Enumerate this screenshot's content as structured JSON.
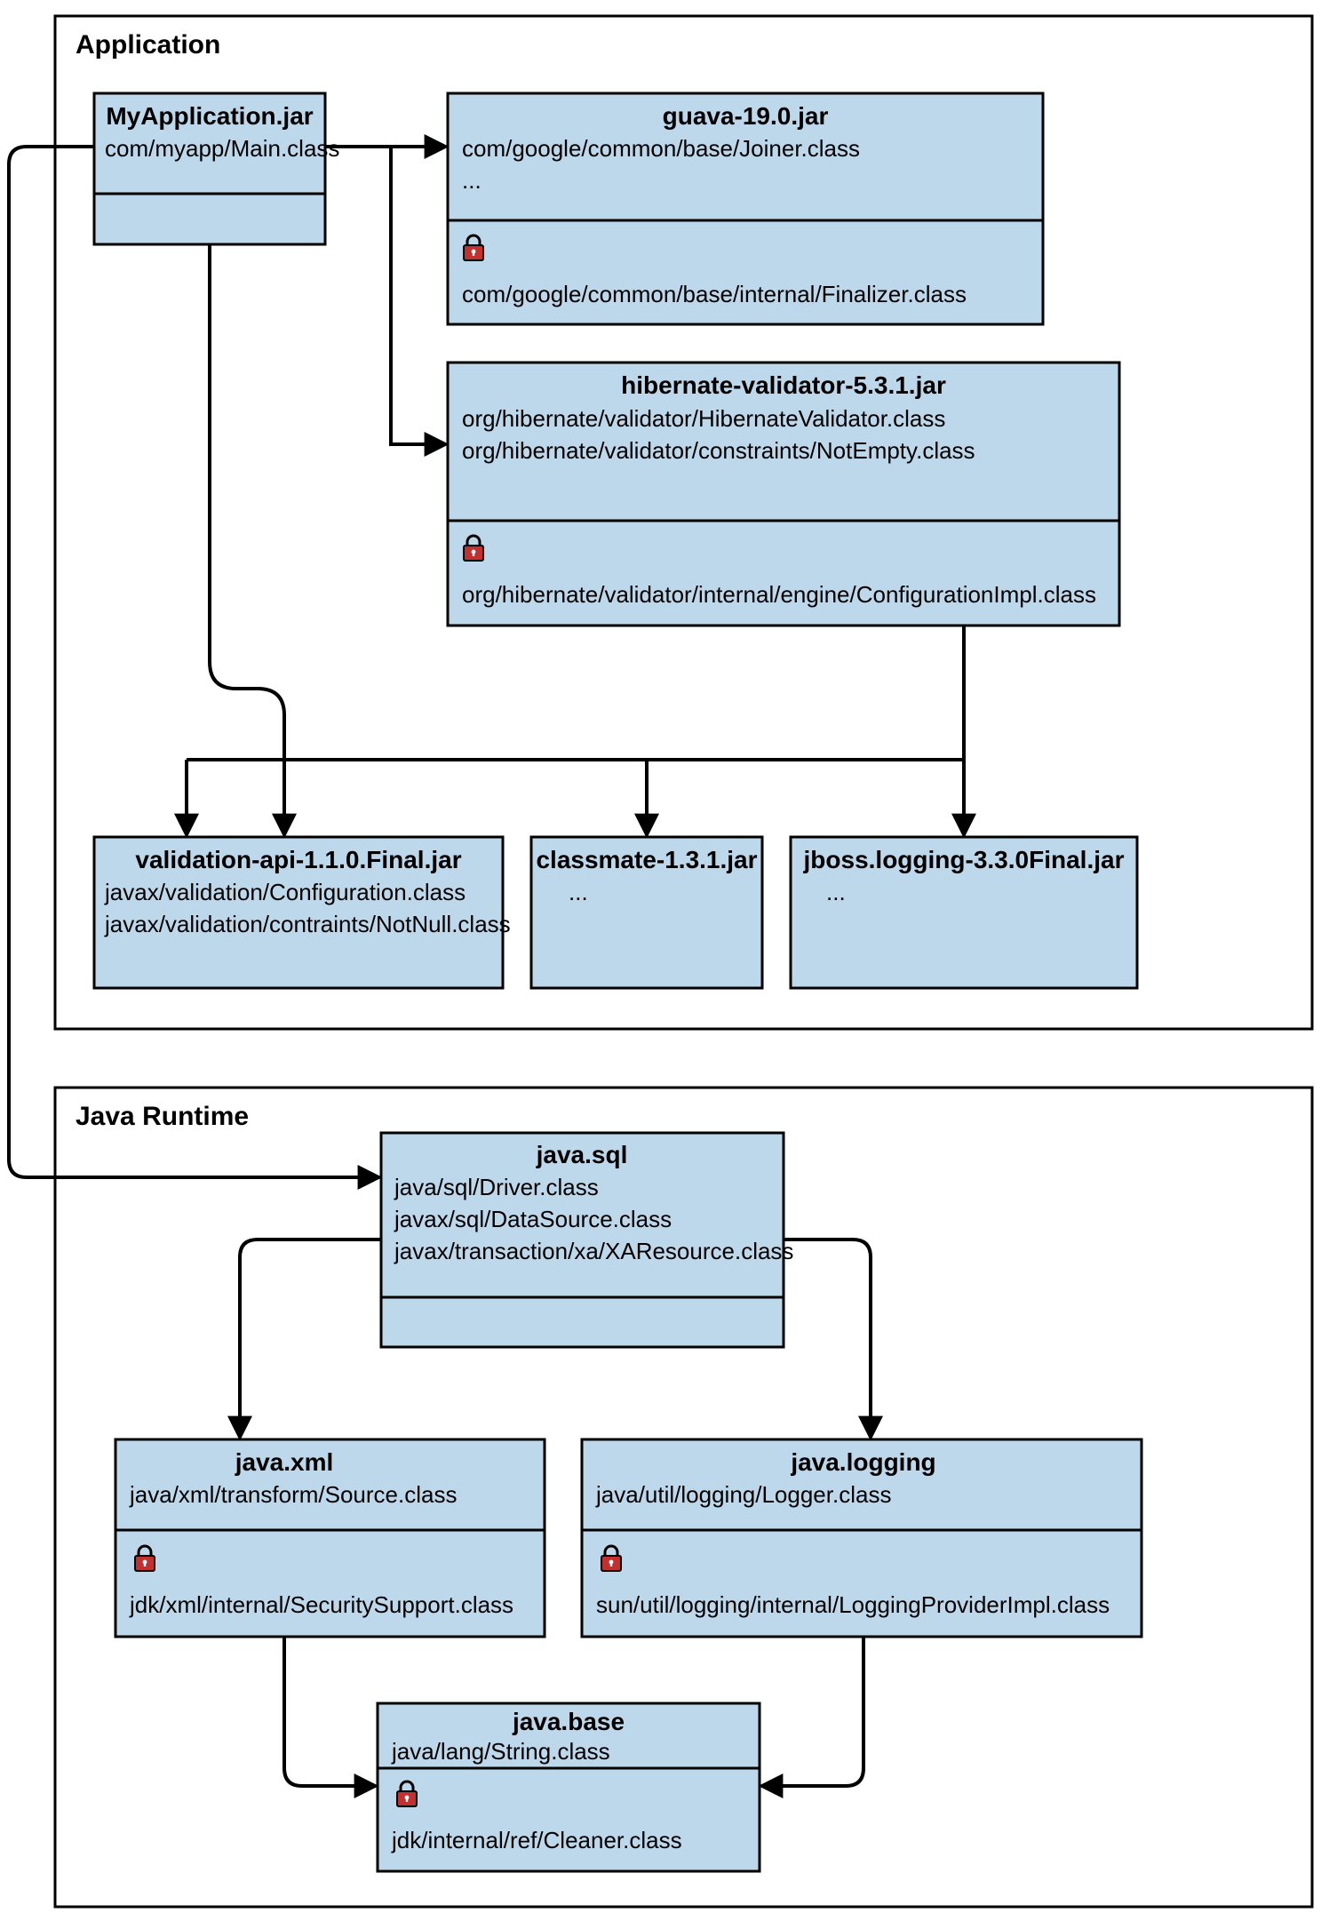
{
  "outer": {
    "application": "Application",
    "runtime": "Java Runtime"
  },
  "modules": {
    "myapp": {
      "title": "MyApplication.jar",
      "lines": [
        "com/myapp/Main.class"
      ]
    },
    "guava": {
      "title": "guava-19.0.jar",
      "lines": [
        "com/google/common/base/Joiner.class",
        "..."
      ],
      "locked": [
        "com/google/common/base/internal/Finalizer.class"
      ]
    },
    "hibernate": {
      "title": "hibernate-validator-5.3.1.jar",
      "lines": [
        "org/hibernate/validator/HibernateValidator.class",
        "org/hibernate/validator/constraints/NotEmpty.class"
      ],
      "locked": [
        "org/hibernate/validator/internal/engine/ConfigurationImpl.class"
      ]
    },
    "validation": {
      "title": "validation-api-1.1.0.Final.jar",
      "lines": [
        "javax/validation/Configuration.class",
        "javax/validation/contraints/NotNull.class"
      ]
    },
    "classmate": {
      "title": "classmate-1.3.1.jar",
      "lines": [
        "..."
      ]
    },
    "jboss": {
      "title": "jboss.logging-3.3.0Final.jar",
      "lines": [
        "..."
      ]
    },
    "sql": {
      "title": "java.sql",
      "lines": [
        "java/sql/Driver.class",
        "javax/sql/DataSource.class",
        "javax/transaction/xa/XAResource.class"
      ]
    },
    "xml": {
      "title": "java.xml",
      "lines": [
        "java/xml/transform/Source.class"
      ],
      "locked": [
        "jdk/xml/internal/SecuritySupport.class"
      ]
    },
    "logging": {
      "title": "java.logging",
      "lines": [
        "java/util/logging/Logger.class"
      ],
      "locked": [
        "sun/util/logging/internal/LoggingProviderImpl.class"
      ]
    },
    "base": {
      "title": "java.base",
      "lines": [
        "java/lang/String.class"
      ],
      "locked": [
        "jdk/internal/ref/Cleaner.class"
      ]
    }
  }
}
